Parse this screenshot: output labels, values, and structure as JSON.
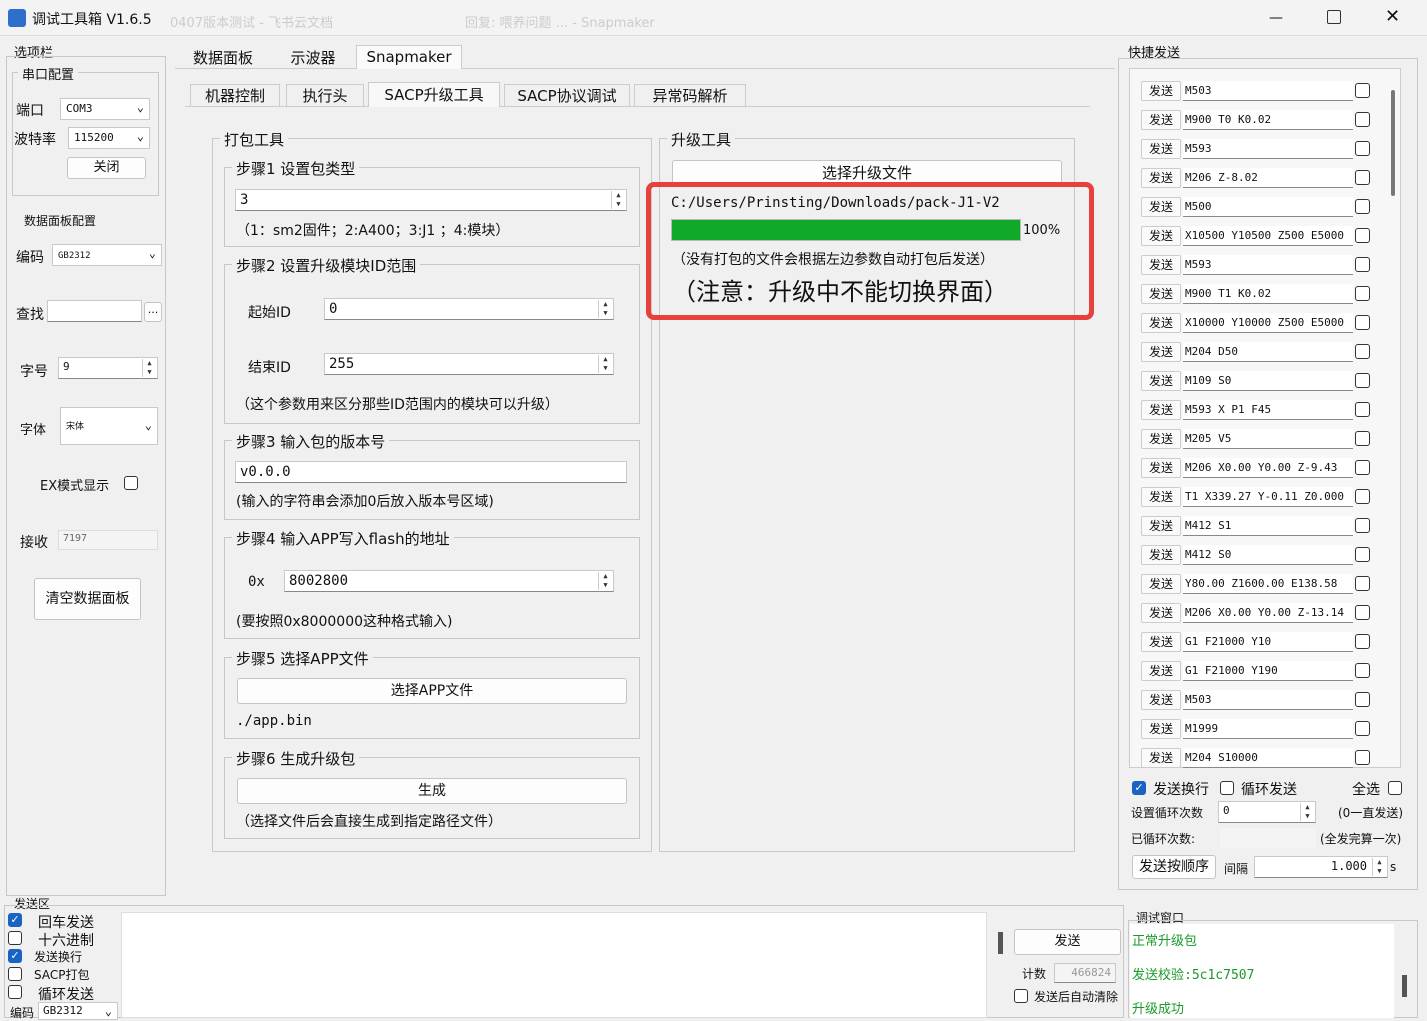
{
  "window": {
    "title": "调试工具箱 V1.6.5",
    "bg_tabs": [
      "0407版本测试 - 飞书云文档",
      "回复: 喂养问题 ... - Snapmaker"
    ]
  },
  "left": {
    "options_label": "选项栏",
    "serial_group": "串口配置",
    "port_label": "端口",
    "port_value": "COM3",
    "baud_label": "波特率",
    "baud_value": "115200",
    "close_btn": "关闭",
    "panel_group": "数据面板配置",
    "encoding_label": "编码",
    "encoding_value": "GB2312",
    "find_label": "查找",
    "find_btn": "...",
    "fontsize_label": "字号",
    "fontsize_value": "9",
    "font_label": "字体",
    "font_value": "宋体",
    "ex_label": "EX模式显示",
    "recv_label": "接收",
    "recv_value": "7197",
    "clear_btn": "清空数据面板"
  },
  "tabs_top": [
    "数据面板",
    "示波器",
    "Snapmaker"
  ],
  "tabs_sub": [
    "机器控制",
    "执行头",
    "SACP升级工具",
    "SACP协议调试",
    "异常码解析"
  ],
  "pack": {
    "group": "打包工具",
    "step1": {
      "label": "步骤1 设置包类型",
      "value": "3",
      "hint": "（1：sm2固件；2:A400；3:J1 ；4:模块）"
    },
    "step2": {
      "label": "步骤2 设置升级模块ID范围",
      "start_label": "起始ID",
      "start_value": "0",
      "end_label": "结束ID",
      "end_value": "255",
      "hint": "（这个参数用来区分那些ID范围内的模块可以升级）"
    },
    "step3": {
      "label": "步骤3 输入包的版本号",
      "value": "v0.0.0",
      "hint": "(输入的字符串会添加0后放入版本号区域)"
    },
    "step4": {
      "label": "步骤4 输入APP写入flash的地址",
      "prefix": "0x",
      "value": "8002800",
      "hint": "(要按照0x8000000这种格式输入)"
    },
    "step5": {
      "label": "步骤5 选择APP文件",
      "button": "选择APP文件",
      "path": "./app.bin"
    },
    "step6": {
      "label": "步骤6 生成升级包",
      "button": "生成",
      "hint": "（选择文件后会直接生成到指定路径文件）"
    }
  },
  "upgrade": {
    "group": "升级工具",
    "button": "选择升级文件",
    "path": "C:/Users/Prinsting/Downloads/pack-J1-V2",
    "progress": 100,
    "progress_label": "100%",
    "note1": "（没有打包的文件会根据左边参数自动打包后发送）",
    "note2": "（注意：升级中不能切换界面）",
    "highlight_color": "#e8403c",
    "progress_color": "#11a92a"
  },
  "quick": {
    "title": "快捷发送",
    "send_label": "发送",
    "commands": [
      "M503",
      "M900 T0 K0.02",
      "M593",
      "M206 Z-8.02",
      "M500",
      "X10500 Y10500 Z500 E5000",
      "M593",
      "M900 T1 K0.02",
      "X10000 Y10000 Z500 E5000",
      "M204 D50",
      "M109 S0",
      "M593 X P1 F45",
      "M205 V5",
      "M206 X0.00 Y0.00 Z-9.43",
      "T1 X339.27 Y-0.11 Z0.000",
      "M412 S1",
      "M412 S0",
      " Y80.00 Z1600.00 E138.58",
      "M206 X0.00 Y0.00 Z-13.14",
      "G1 F21000 Y10",
      "G1 F21000 Y190",
      "M503",
      "M1999",
      "M204 S10000"
    ],
    "send_newline": "发送换行",
    "loop_send": "循环发送",
    "select_all": "全选",
    "loop_count_label": "设置循环次数",
    "loop_count_value": "0",
    "loop_hint": "(0一直发送)",
    "looped_label": "已循环次数:",
    "looped_hint": "(全发完算一次)",
    "order_btn": "发送按顺序",
    "interval_label": "间隔",
    "interval_value": "1.000",
    "interval_unit": "s"
  },
  "send_area": {
    "title": "发送区",
    "opts": [
      {
        "label": "回车发送",
        "checked": true
      },
      {
        "label": "十六进制",
        "checked": false
      },
      {
        "label": "发送换行",
        "checked": true
      },
      {
        "label": "SACP打包",
        "checked": false
      },
      {
        "label": "循环发送",
        "checked": false
      }
    ],
    "encoding_label": "编码",
    "encoding_value": "GB2312",
    "send_btn": "发送",
    "count_label": "计数",
    "count_value": "466824",
    "auto_clear": "发送后自动清除"
  },
  "debug": {
    "title": "调试窗口",
    "lines": [
      "正常升级包",
      "发送校验:5c1c7507",
      "升级成功"
    ],
    "text_color": "#1a9a2a"
  }
}
